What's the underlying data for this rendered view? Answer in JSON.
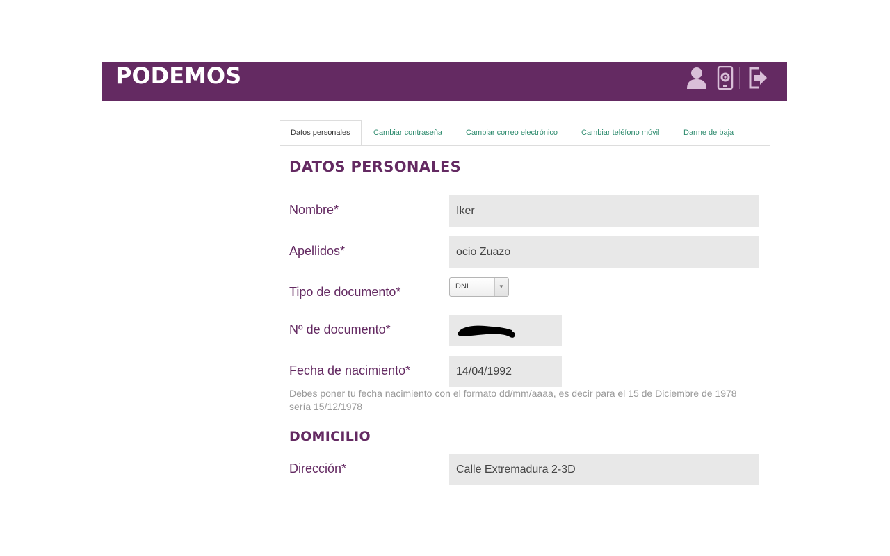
{
  "header": {
    "logo": "PODEMOS",
    "icons": [
      "user-icon",
      "mobile-settings-icon",
      "logout-icon"
    ]
  },
  "tabs": [
    {
      "label": "Datos personales",
      "active": true
    },
    {
      "label": "Cambiar contraseña",
      "active": false
    },
    {
      "label": "Cambiar correo electrónico",
      "active": false
    },
    {
      "label": "Cambiar teléfono móvil",
      "active": false
    },
    {
      "label": "Darme de baja",
      "active": false
    }
  ],
  "personal": {
    "title": "DATOS PERSONALES",
    "nombre_label": "Nombre*",
    "nombre_value": "Iker",
    "apellidos_label": "Apellidos*",
    "apellidos_value": "ocio Zuazo",
    "tipo_label": "Tipo de documento*",
    "tipo_value": "DNI",
    "numero_label": "Nº de documento*",
    "fecha_label": "Fecha de nacimiento*",
    "fecha_value": "14/04/1992",
    "fecha_help": "Debes poner tu fecha nacimiento con el formato dd/mm/aaaa, es decir para el 15 de Diciembre de 1978 sería 15/12/1978"
  },
  "domicilio": {
    "title": "DOMICILIO",
    "direccion_label": "Dirección*",
    "direccion_value": "Calle Extremadura 2-3D"
  },
  "colors": {
    "brand": "#642a62",
    "tab_link": "#2e8b6e",
    "input_bg": "#e8e8e8"
  }
}
